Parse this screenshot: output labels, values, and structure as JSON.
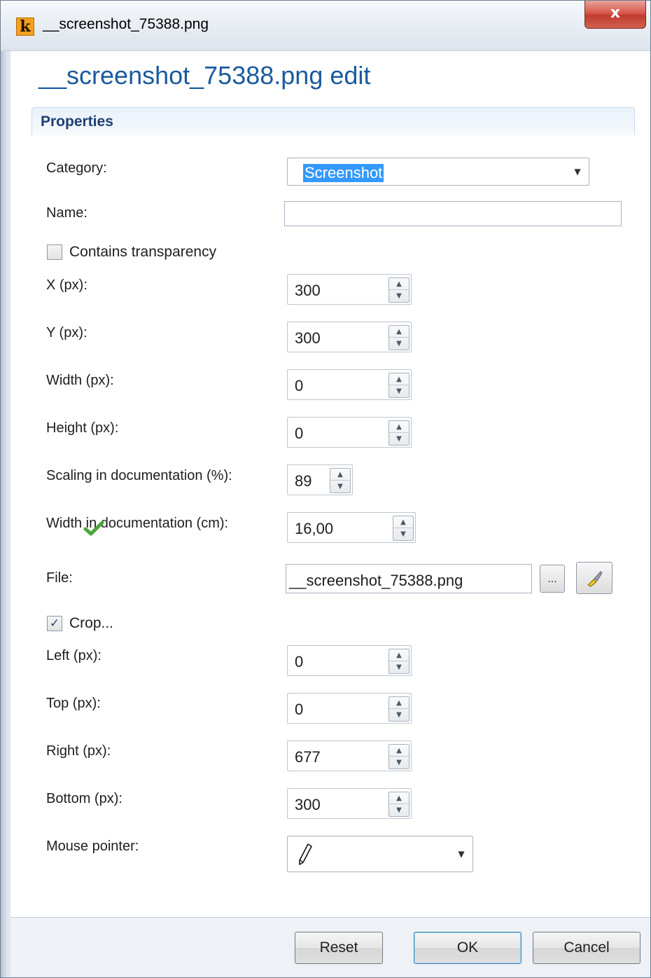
{
  "window": {
    "title": "__screenshot_75388.png",
    "close_label": "x",
    "app_icon_letter": "k"
  },
  "heading": "__screenshot_75388.png edit",
  "section": {
    "title": "Properties"
  },
  "fields": {
    "category": {
      "label": "Category:",
      "value": "Screenshot"
    },
    "name": {
      "label": "Name:",
      "value": ""
    },
    "transparency": {
      "label": "Contains transparency",
      "checked": false
    },
    "x": {
      "label": "X (px):",
      "value": "300"
    },
    "y": {
      "label": "Y (px):",
      "value": "300"
    },
    "width": {
      "label": "Width (px):",
      "value": "0"
    },
    "height": {
      "label": "Height (px):",
      "value": "0"
    },
    "scaling": {
      "label": "Scaling in documentation (%):",
      "value": "89"
    },
    "doc_width": {
      "label": "Width in documentation (cm):",
      "value": "16,00"
    },
    "file": {
      "label": "File:",
      "value": "__screenshot_75388.png",
      "browse_label": "...",
      "status_icon": "checkmark-icon"
    },
    "crop": {
      "label": "Crop...",
      "checked": true,
      "check_glyph": "✓"
    },
    "left": {
      "label": "Left (px):",
      "value": "0"
    },
    "top": {
      "label": "Top (px):",
      "value": "0"
    },
    "right": {
      "label": "Right (px):",
      "value": "677"
    },
    "bottom": {
      "label": "Bottom (px):",
      "value": "300"
    },
    "pointer": {
      "label": "Mouse pointer:",
      "icon": "pencil-icon"
    }
  },
  "buttons": {
    "reset": "Reset",
    "ok": "OK",
    "cancel": "Cancel"
  },
  "colors": {
    "heading": "#1a5a9e",
    "section_title": "#1e3f73",
    "selection": "#3399ff",
    "check_icon": "#4aa53a"
  }
}
